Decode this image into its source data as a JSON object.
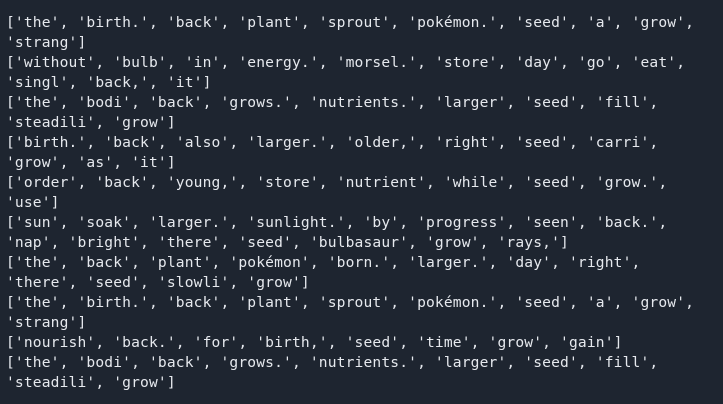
{
  "terminal": {
    "lines": [
      "['the', 'birth.', 'back', 'plant', 'sprout', 'pokémon.', 'seed', 'a', 'grow',",
      "'strang']",
      "['without', 'bulb', 'in', 'energy.', 'morsel.', 'store', 'day', 'go', 'eat',",
      "'singl', 'back,', 'it']",
      "['the', 'bodi', 'back', 'grows.', 'nutrients.', 'larger', 'seed', 'fill',",
      "'steadili', 'grow']",
      "['birth.', 'back', 'also', 'larger.', 'older,', 'right', 'seed', 'carri',",
      "'grow', 'as', 'it']",
      "['order', 'back', 'young,', 'store', 'nutrient', 'while', 'seed', 'grow.',",
      "'use']",
      "['sun', 'soak', 'larger.', 'sunlight.', 'by', 'progress', 'seen', 'back.',",
      "'nap', 'bright', 'there', 'seed', 'bulbasaur', 'grow', 'rays,']",
      "['the', 'back', 'plant', 'pokémon', 'born.', 'larger.', 'day', 'right',",
      "'there', 'seed', 'slowli', 'grow']",
      "['the', 'birth.', 'back', 'plant', 'sprout', 'pokémon.', 'seed', 'a', 'grow',",
      "'strang']",
      "['nourish', 'back.', 'for', 'birth,', 'seed', 'time', 'grow', 'gain']",
      "['the', 'bodi', 'back', 'grows.', 'nutrients.', 'larger', 'seed', 'fill',",
      "'steadili', 'grow']"
    ]
  }
}
